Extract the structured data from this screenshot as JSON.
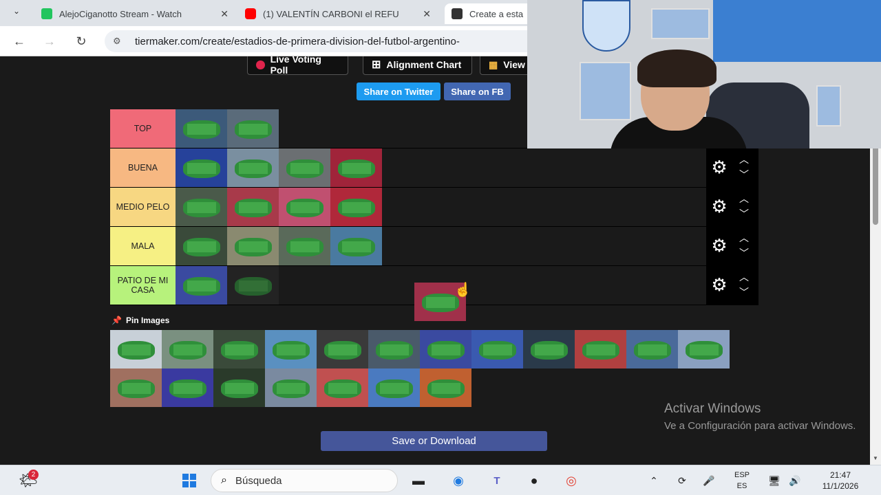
{
  "browser": {
    "tabs": [
      {
        "title": "AlejoCiganotto Stream - Watch",
        "color": "#22c55e"
      },
      {
        "title": "(1) VALENTÍN CARBONI el REFU",
        "color": "#ff0000"
      },
      {
        "title": "Create a esta",
        "color": "#333333"
      }
    ],
    "close_glyph": "✕",
    "url": "tiermaker.com/create/estadios-de-primera-division-del-futbol-argentino-"
  },
  "toolbar": {
    "live_voting": "Live Voting Poll",
    "alignment": "Alignment Chart",
    "view": "View",
    "share_twitter": "Share on Twitter",
    "share_fb": "Share on FB"
  },
  "colors": {
    "twitter": "#1d9bf0",
    "fb": "#4267b2",
    "tier_top": "#ff7f7f",
    "tier_buena": "#ffbf7f",
    "tier_medio": "#ffdf7f",
    "tier_mala": "#ffff7f",
    "tier_patio": "#bfff7f"
  },
  "tiers": [
    {
      "label": "TOP",
      "color": "#f06a78",
      "count": 2
    },
    {
      "label": "BUENA",
      "color": "#f7b882",
      "count": 4
    },
    {
      "label": "MEDIO PELO",
      "color": "#f7d782",
      "count": 4
    },
    {
      "label": "MALA",
      "color": "#f6f084",
      "count": 4
    },
    {
      "label": "PATIO DE MI CASA",
      "color": "#b7f27c",
      "count": 2
    }
  ],
  "pin_images": "Pin Images",
  "pool_count": 19,
  "save_button": "Save or Download",
  "watermark": {
    "title": "Activar Windows",
    "subtitle": "Ve a Configuración para activar Windows."
  },
  "taskbar": {
    "search_placeholder": "Búsqueda",
    "notification_count": "2",
    "lang_top": "ESP",
    "lang_bottom": "ES",
    "time": "21:47",
    "date": "11/1/2026"
  }
}
